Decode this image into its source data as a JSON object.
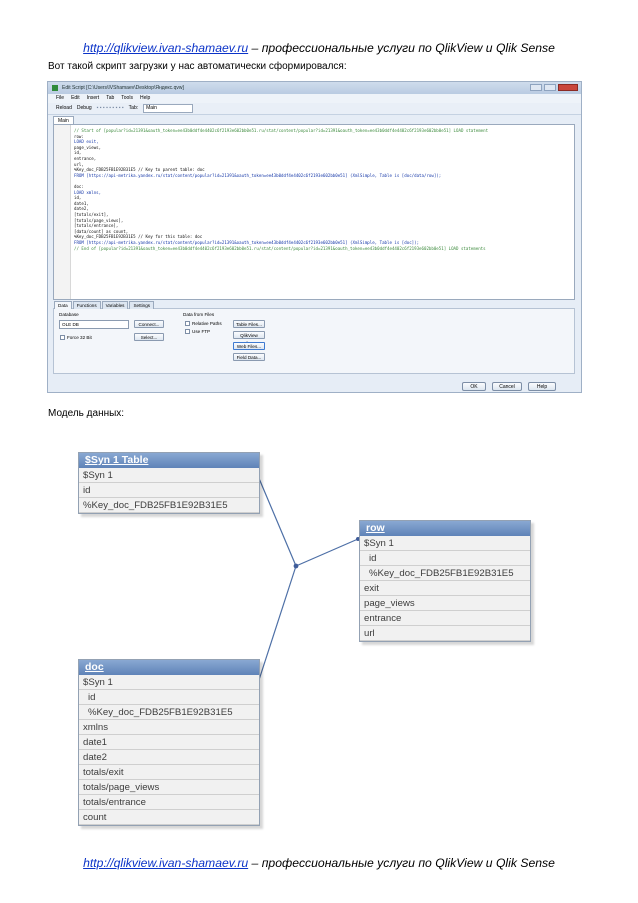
{
  "header": {
    "url": "http://qlikview.ivan-shamaev.ru",
    "tagline": " – профессиональные услуги по QlikView и Qlik Sense"
  },
  "paragraphs": {
    "intro": "Вот такой скрипт загрузки у нас автоматически сформировался:",
    "model": "Модель данных:"
  },
  "editor": {
    "title": "Edit Script [C:\\Users\\IVShamaev\\Desktop\\Яндекс.qvw]",
    "menu": [
      "File",
      "Edit",
      "Insert",
      "Tab",
      "Tools",
      "Help"
    ],
    "toolbar": {
      "reload": "Reload",
      "debug": "Debug",
      "tab_label": "Tab:",
      "tab_value": "Main"
    },
    "tab": "Main",
    "code_lines": [
      {
        "t": "// Start of [popular?id=21391&oauth_token=ee43b0ddf4e4402c6f2193e602bb0e51.ru/stat/content/popular?id=21391&oauth_token=ee43b0ddf4e4402c6f2193e602bb0e51] LOAD statement",
        "k": "cm"
      },
      {
        "t": "row:",
        "k": "tx"
      },
      {
        "t": "LOAD exit,",
        "k": "kw"
      },
      {
        "t": "     page_views,",
        "k": "tx"
      },
      {
        "t": "     id,",
        "k": "tx"
      },
      {
        "t": "     entrance,",
        "k": "tx"
      },
      {
        "t": "     url,",
        "k": "tx"
      },
      {
        "t": "     %Key_doc_FDB25FB1E92B31E5    // Key to parent table: doc",
        "k": "tx"
      },
      {
        "t": "FROM [https://api-metrika.yandex.ru/stat/content/popular?id=21391&oauth_token=ee43b0ddf4e4402c6f2193e602bb0e51] (XmlSimple, Table is [doc/data/row]);",
        "k": "kw"
      },
      {
        "t": "",
        "k": "tx"
      },
      {
        "t": "doc:",
        "k": "tx"
      },
      {
        "t": "LOAD xmlns,",
        "k": "kw"
      },
      {
        "t": "     id,",
        "k": "tx"
      },
      {
        "t": "     date1,",
        "k": "tx"
      },
      {
        "t": "     date2,",
        "k": "tx"
      },
      {
        "t": "     [totals/exit],",
        "k": "tx"
      },
      {
        "t": "     [totals/page_views],",
        "k": "tx"
      },
      {
        "t": "     [totals/entrance],",
        "k": "tx"
      },
      {
        "t": "     [data/count] as count,",
        "k": "tx"
      },
      {
        "t": "     %Key_doc_FDB25FB1E92B31E5    // Key for this table: doc",
        "k": "tx"
      },
      {
        "t": "FROM [https://api-metrika.yandex.ru/stat/content/popular?id=21391&oauth_token=ee43b0ddf4e4402c6f2193e602bb0e51] (XmlSimple, Table is [doc]);",
        "k": "kw"
      },
      {
        "t": "// End of [popular?id=21391&oauth_token=ee43b0ddf4e4402c6f2193e602bb0e51.ru/stat/content/popular?id=21391&oauth_token=ee43b0ddf4e4402c6f2193e602bb0e51] LOAD statements",
        "k": "cm"
      }
    ],
    "lower_tabs": [
      "Data",
      "Functions",
      "Variables",
      "Settings"
    ],
    "database_label": "Database",
    "database_value": "OLE DB",
    "connect": "Connect...",
    "select": "Select...",
    "force32": "Force 32 Bit",
    "data_from_files": "Data from Files",
    "relative_paths": "Relative Paths",
    "use_ftp": "Use FTP",
    "table_files": "Table Files...",
    "qlikview_file": "QlikView File...",
    "web_files": "Web Files...",
    "field_data": "Field Data...",
    "ok": "OK",
    "cancel": "Cancel",
    "help": "Help"
  },
  "model": {
    "tables": [
      {
        "name": "$Syn 1 Table",
        "fields": [
          {
            "label": "$Syn 1",
            "indent": false
          },
          {
            "label": "id",
            "indent": false
          },
          {
            "label": "%Key_doc_FDB25FB1E92B31E5",
            "indent": false
          }
        ]
      },
      {
        "name": "row",
        "fields": [
          {
            "label": "$Syn 1",
            "indent": false
          },
          {
            "label": "id",
            "indent": true
          },
          {
            "label": "%Key_doc_FDB25FB1E92B31E5",
            "indent": true
          },
          {
            "label": "exit",
            "indent": false
          },
          {
            "label": "page_views",
            "indent": false
          },
          {
            "label": "entrance",
            "indent": false
          },
          {
            "label": "url",
            "indent": false
          }
        ]
      },
      {
        "name": "doc",
        "fields": [
          {
            "label": "$Syn 1",
            "indent": false
          },
          {
            "label": "id",
            "indent": true
          },
          {
            "label": "%Key_doc_FDB25FB1E92B31E5",
            "indent": true
          },
          {
            "label": "xmlns",
            "indent": false
          },
          {
            "label": "date1",
            "indent": false
          },
          {
            "label": "date2",
            "indent": false
          },
          {
            "label": "totals/exit",
            "indent": false
          },
          {
            "label": "totals/page_views",
            "indent": false
          },
          {
            "label": "totals/entrance",
            "indent": false
          },
          {
            "label": "count",
            "indent": false
          }
        ]
      }
    ]
  }
}
